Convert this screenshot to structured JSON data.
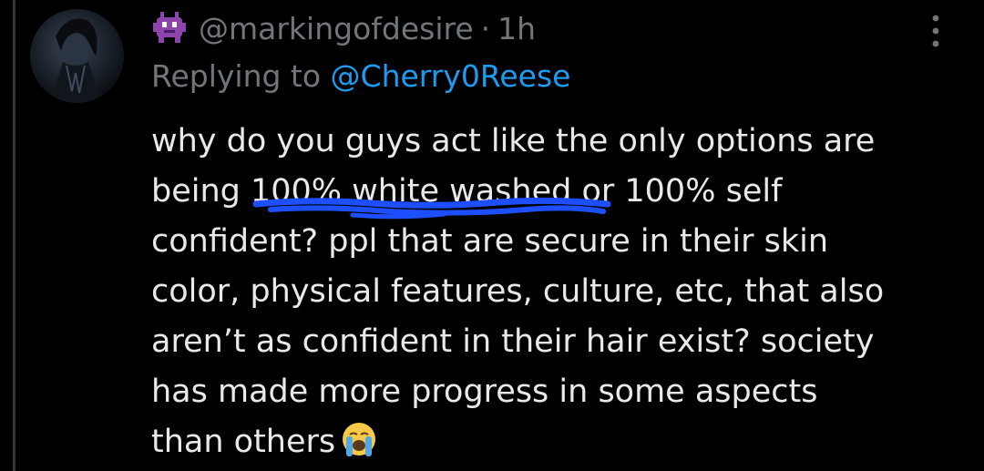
{
  "reply": {
    "author_handle": "@markingofdesire",
    "separator": "·",
    "time": "1h",
    "replying_prefix": "Replying to",
    "replying_to": "@Cherry0Reese",
    "author_badge_icon": "alien-monster-icon",
    "text_lines": [
      "why do you guys act like the only options are",
      "being 100% white washed or 100% self",
      "confident? ppl that are secure in their skin",
      "color, physical features, culture, etc, that also",
      "aren’t as confident in their hair exist? society",
      "has made more progress in some aspects",
      "than others"
    ],
    "text_line_2_parts": [
      "being ",
      "100% white washed",
      " or 100% self"
    ],
    "trailing_emoji": "loudly-crying-face-icon"
  },
  "colors": {
    "background": "#000000",
    "text": "#e7e9ea",
    "muted": "#71767b",
    "link": "#1d9bf0",
    "scribble": "#1d4fff",
    "thread_line": "#333639"
  }
}
